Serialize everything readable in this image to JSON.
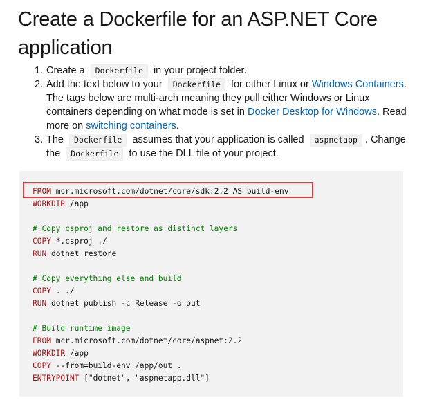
{
  "title": "Create a Dockerfile for an ASP.NET Core application",
  "steps": [
    {
      "num": "1.",
      "pre": "Create a",
      "code": "Dockerfile",
      "post": "in your project folder."
    },
    {
      "num": "2.",
      "pre": "Add the text below to your",
      "code": "Dockerfile",
      "mid": "for either Linux or",
      "link1": "Windows Containers",
      "text2": ". The tags below are multi-arch meaning they pull either Windows or Linux containers depending on what mode is set in",
      "link2": "Docker Desktop for Windows",
      "text3": ". Read more on",
      "link3": "switching containers",
      "text4": "."
    },
    {
      "num": "3.",
      "pre": "The",
      "code": "Dockerfile",
      "mid": "assumes that your application is called",
      "code2": "aspnetapp",
      "mid2": ". Change the",
      "code3": "Dockerfile",
      "post": "to use the DLL file of your project."
    }
  ],
  "code_lines": [
    {
      "kw": "FROM",
      "val": " mcr.microsoft.com/dotnet/core/sdk:2.2 AS build-env"
    },
    {
      "kw": "WORKDIR",
      "val": " /app"
    },
    {
      "blank": true
    },
    {
      "comment": "# Copy csproj and restore as distinct layers"
    },
    {
      "kw": "COPY",
      "val": " *.csproj ./"
    },
    {
      "kw": "RUN",
      "val": " dotnet restore"
    },
    {
      "blank": true
    },
    {
      "comment": "# Copy everything else and build"
    },
    {
      "kw": "COPY",
      "val": " . ./"
    },
    {
      "kw": "RUN",
      "val": " dotnet publish -c Release -o out"
    },
    {
      "blank": true
    },
    {
      "comment": "# Build runtime image"
    },
    {
      "kw": "FROM",
      "val": " mcr.microsoft.com/dotnet/core/aspnet:2.2"
    },
    {
      "kw": "WORKDIR",
      "val": " /app"
    },
    {
      "kw": "COPY",
      "val": " --from=build-env /app/out ."
    },
    {
      "kw": "ENTRYPOINT",
      "val": " [\"dotnet\", \"aspnetapp.dll\"]"
    }
  ],
  "colors": {
    "keyword": "#a31515",
    "comment": "#008000",
    "link": "#0065b3",
    "highlight_border": "#e03c3c",
    "code_background": "#f2f2f2"
  }
}
